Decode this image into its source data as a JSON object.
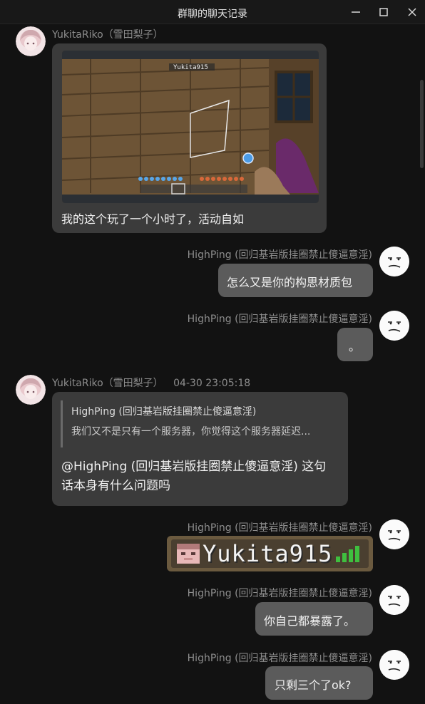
{
  "window": {
    "title": "群聊的聊天记录",
    "minimize_icon": "minimize-icon",
    "maximize_icon": "maximize-icon",
    "close_icon": "close-icon"
  },
  "messages": [
    {
      "sender": "YukitaRiko（雪田梨子）",
      "side": "left",
      "image": {
        "kind": "game-screenshot",
        "overlay_name": "Yukita915"
      },
      "text": "我的这个玩了一个小时了，活动自如"
    },
    {
      "sender": "HighPing (回归基岩版挂圈禁止傻逼意淫)",
      "side": "right",
      "text": "怎么又是你的构思材质包"
    },
    {
      "sender": "HighPing (回归基岩版挂圈禁止傻逼意淫)",
      "side": "right",
      "text": "。"
    },
    {
      "sender": "YukitaRiko（雪田梨子）",
      "timestamp": "04-30 23:05:18",
      "side": "left",
      "quote": {
        "name": "HighPing (回归基岩版挂圈禁止傻逼意淫)",
        "text": "我们又不是只有一个服务器，你觉得这个服务器延迟..."
      },
      "text_line1": "@HighPing (回归基岩版挂圈禁止傻逼意淫) 这句",
      "text_line2": "话本身有什么问题吗"
    },
    {
      "sender": "HighPing (回归基岩版挂圈禁止傻逼意淫)",
      "side": "right",
      "image": {
        "kind": "nametag",
        "name": "Yukita915"
      }
    },
    {
      "sender": "HighPing (回归基岩版挂圈禁止傻逼意淫)",
      "side": "right",
      "text": "你自己都暴露了。"
    },
    {
      "sender": "HighPing (回归基岩版挂圈禁止傻逼意淫)",
      "side": "right",
      "text": "只剩三个了ok?"
    }
  ]
}
